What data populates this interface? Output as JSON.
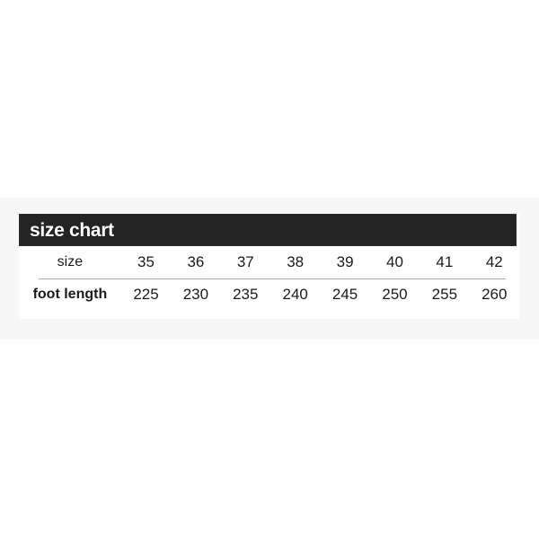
{
  "page": {
    "background_color": "#ffffff",
    "band_color": "#f7f7f7"
  },
  "chart": {
    "header": {
      "title": "size chart",
      "background_color": "#242424",
      "text_color": "#ffffff"
    },
    "rows": [
      {
        "label": "size",
        "emphasis": false,
        "values": [
          "35",
          "36",
          "37",
          "38",
          "39",
          "40",
          "41",
          "42"
        ]
      },
      {
        "label": "foot length",
        "emphasis": true,
        "values": [
          "225",
          "230",
          "235",
          "240",
          "245",
          "250",
          "255",
          "260"
        ]
      }
    ]
  },
  "chart_data": {
    "type": "table",
    "title": "size chart",
    "categories": [
      "35",
      "36",
      "37",
      "38",
      "39",
      "40",
      "41",
      "42"
    ],
    "row_headers": [
      "size",
      "foot length"
    ],
    "series": [
      {
        "name": "size",
        "values": [
          35,
          36,
          37,
          38,
          39,
          40,
          41,
          42
        ]
      },
      {
        "name": "foot length",
        "values": [
          225,
          230,
          235,
          240,
          245,
          250,
          255,
          260
        ]
      }
    ],
    "xlabel": "",
    "ylabel": "",
    "grid": false,
    "legend": "none"
  }
}
